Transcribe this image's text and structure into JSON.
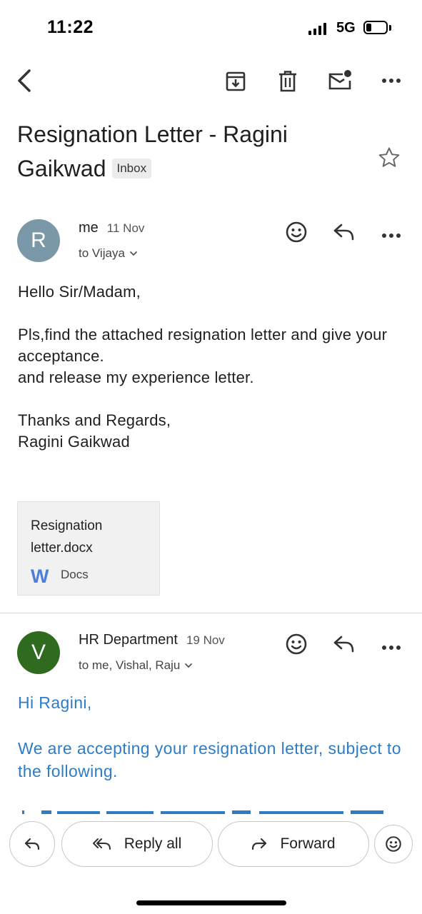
{
  "status_bar": {
    "time": "11:22",
    "network": "5G"
  },
  "toolbar": {
    "back_icon": "chevron-left-icon",
    "archive_icon": "archive-icon",
    "delete_icon": "trash-icon",
    "mark_unread_icon": "mail-unread-icon",
    "more_icon": "more-horizontal-icon"
  },
  "email": {
    "subject": "Resignation Letter - Ragini Gaikwad",
    "label": "Inbox"
  },
  "messages": [
    {
      "avatar_letter": "R",
      "avatar_color": "#7a98a8",
      "sender": "me",
      "date": "11 Nov",
      "recipients": "to Vijaya",
      "body": [
        "Hello Sir/Madam,",
        "",
        "Pls,find the attached resignation letter and give your acceptance.",
        "and release my experience letter.",
        "",
        "Thanks and Regards,",
        "Ragini Gaikwad"
      ],
      "attachment": {
        "name": "Resignation letter.docx",
        "type": "Docs",
        "icon_letter": "W"
      }
    },
    {
      "avatar_letter": "V",
      "avatar_color": "#2e6b1f",
      "sender": "HR Department",
      "date": "19 Nov",
      "recipients": "to me, Vishal, Raju",
      "body": [
        "Hi Ragini,",
        "",
        "We are accepting your resignation letter, subject to the following."
      ],
      "body_color": "#2f7cc6"
    }
  ],
  "bottom_bar": {
    "reply_all_label": "Reply all",
    "forward_label": "Forward"
  }
}
